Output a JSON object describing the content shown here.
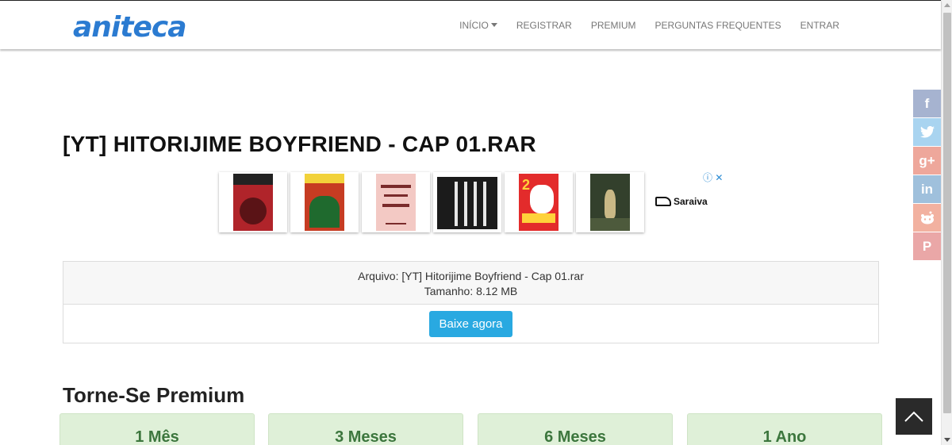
{
  "header": {
    "logo": "aniteca",
    "nav": [
      {
        "label": "INÍCIO",
        "dropdown": true
      },
      {
        "label": "REGISTRAR"
      },
      {
        "label": "PREMIUM"
      },
      {
        "label": "PERGUNTAS FREQUENTES"
      },
      {
        "label": "ENTRAR"
      }
    ]
  },
  "page": {
    "title": "[YT] HITORIJIME BOYFRIEND - CAP 01.RAR"
  },
  "ad": {
    "brand": "Saraiva",
    "close_glyph": "ⓘ ✕",
    "books": [
      {
        "cover_color": "#b0242a",
        "accent": "#222"
      },
      {
        "cover_color": "#c63c22",
        "accent": "#1f6a2e"
      },
      {
        "cover_color": "#f3c9c4",
        "accent": "#7a2b2b"
      },
      {
        "cover_color": "#1b1b1b",
        "accent": "#e7e7e7"
      },
      {
        "cover_color": "#e32b2b",
        "accent": "#ffd23a"
      },
      {
        "cover_color": "#33402c",
        "accent": "#c9b886"
      }
    ]
  },
  "file": {
    "name_line": "Arquivo: [YT] Hitorijime Boyfriend - Cap 01.rar",
    "size_line": "Tamanho: 8.12 MB",
    "download_label": "Baixe agora"
  },
  "premium": {
    "title": "Torne-Se Premium",
    "plans": [
      "1 Mês",
      "3 Meses",
      "6 Meses",
      "1 Ano"
    ]
  },
  "social": [
    {
      "name": "facebook",
      "glyph": "f",
      "color": "#a6b3d0"
    },
    {
      "name": "twitter",
      "glyph": "🐦",
      "color": "#a9d4f0"
    },
    {
      "name": "google-plus",
      "glyph": "g+",
      "color": "#eea79b"
    },
    {
      "name": "linkedin",
      "glyph": "in",
      "color": "#9fc0dc"
    },
    {
      "name": "reddit",
      "glyph": "●",
      "color": "#f2b1a0"
    },
    {
      "name": "pinterest",
      "glyph": "P",
      "color": "#eaa7a7"
    }
  ],
  "colors": {
    "logo": "#2b7bd1",
    "download_button": "#29a9e1",
    "plan_bg": "#dff0d8",
    "plan_text": "#3c763d"
  }
}
